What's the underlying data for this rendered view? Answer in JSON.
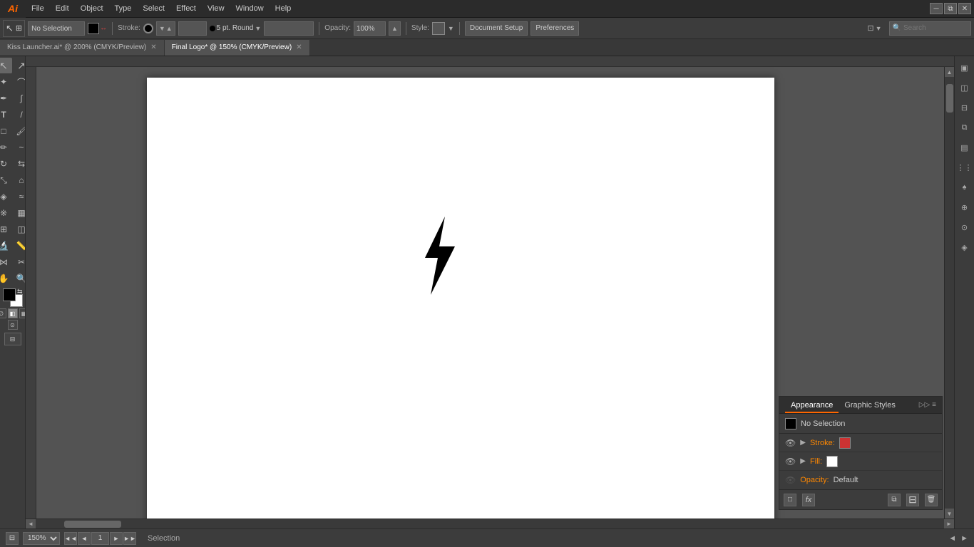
{
  "app": {
    "logo": "Ai",
    "title": "Adobe Illustrator"
  },
  "menu": {
    "items": [
      "File",
      "Edit",
      "Object",
      "Type",
      "Select",
      "Effect",
      "View",
      "Window",
      "Help"
    ]
  },
  "toolbar": {
    "selection_label": "No Selection",
    "stroke_label": "Stroke:",
    "stroke_weight": "5 pt. Round",
    "opacity_label": "Opacity:",
    "opacity_value": "100%",
    "style_label": "Style:",
    "doc_setup_btn": "Document Setup",
    "preferences_btn": "Preferences"
  },
  "tabs": [
    {
      "label": "Kiss Launcher.ai* @ 200% (CMYK/Preview)",
      "active": false
    },
    {
      "label": "Final Logo* @ 150% (CMYK/Preview)",
      "active": true
    }
  ],
  "status_bar": {
    "zoom": "150%",
    "page": "1",
    "status": "Selection"
  },
  "appearance_panel": {
    "title": "Appearance",
    "tab2": "Graphic Styles",
    "selection_label": "No Selection",
    "stroke_label": "Stroke:",
    "fill_label": "Fill:",
    "opacity_label": "Opacity:",
    "opacity_value": "Default"
  }
}
